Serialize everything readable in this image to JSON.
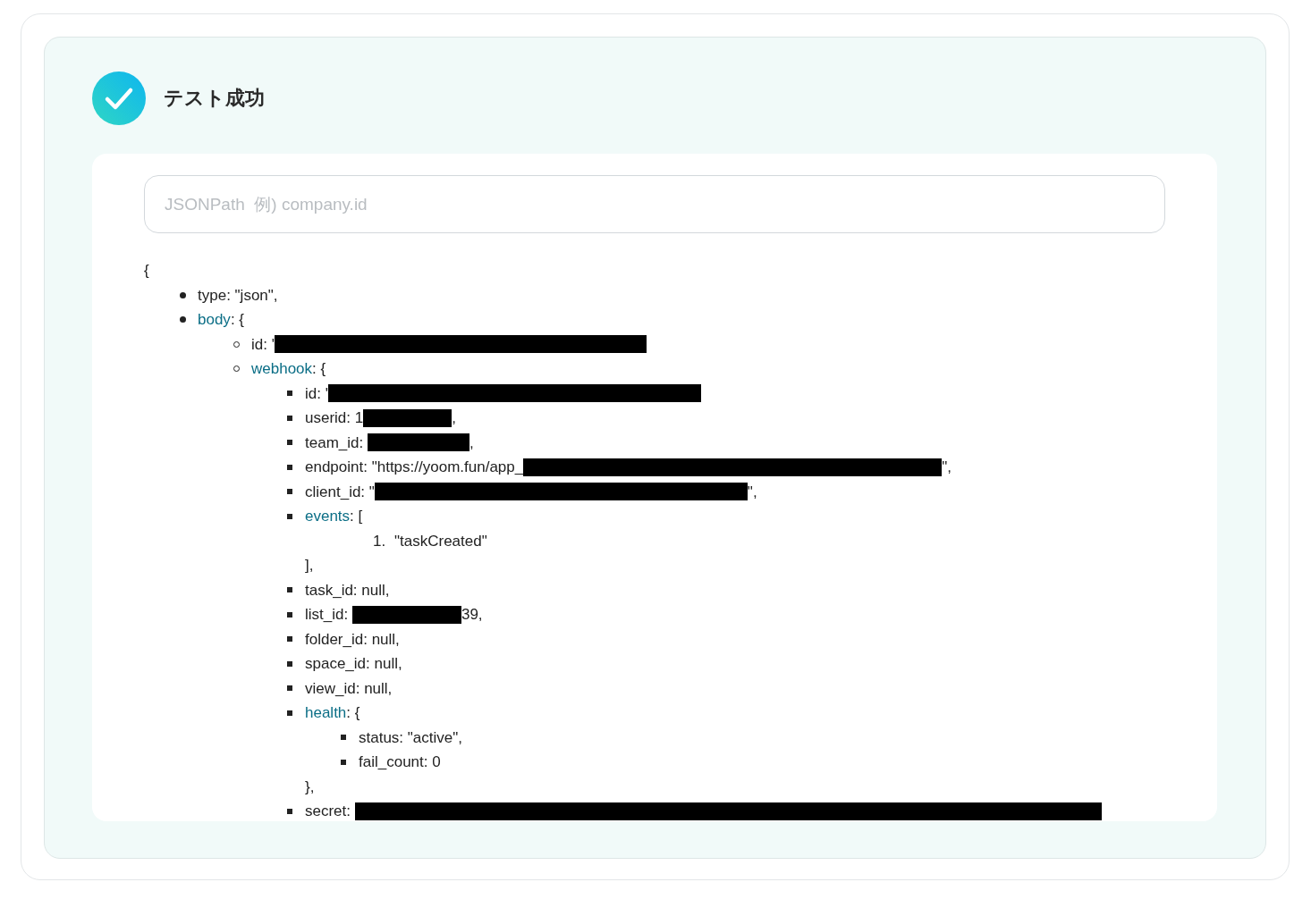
{
  "header": {
    "title": "テスト成功",
    "success": true
  },
  "search": {
    "placeholder": "JSONPath  例) company.id"
  },
  "tree": {
    "open": "{",
    "items": [
      {
        "parts": [
          {
            "kind": "text",
            "text": "type: \"json\","
          }
        ]
      },
      {
        "parts": [
          {
            "kind": "link",
            "text": "body"
          },
          {
            "kind": "text",
            "text": ": {"
          }
        ],
        "children": [
          {
            "parts": [
              {
                "kind": "text",
                "text": "id: '"
              },
              {
                "kind": "redaction"
              }
            ]
          },
          {
            "parts": [
              {
                "kind": "link",
                "text": "webhook"
              },
              {
                "kind": "text",
                "text": ": {"
              }
            ],
            "children": [
              {
                "parts": [
                  {
                    "kind": "text",
                    "text": "id: '"
                  },
                  {
                    "kind": "redaction"
                  }
                ]
              },
              {
                "parts": [
                  {
                    "kind": "text",
                    "text": "userid: 1"
                  },
                  {
                    "kind": "redaction"
                  },
                  {
                    "kind": "text",
                    "text": ","
                  }
                ]
              },
              {
                "parts": [
                  {
                    "kind": "text",
                    "text": "team_id: "
                  },
                  {
                    "kind": "redaction"
                  },
                  {
                    "kind": "text",
                    "text": ","
                  }
                ]
              },
              {
                "parts": [
                  {
                    "kind": "text",
                    "text": "endpoint: \"https://yoom.fun/app_"
                  },
                  {
                    "kind": "redaction"
                  },
                  {
                    "kind": "text",
                    "text": "\","
                  }
                ]
              },
              {
                "parts": [
                  {
                    "kind": "text",
                    "text": "client_id: \""
                  },
                  {
                    "kind": "redaction"
                  },
                  {
                    "kind": "text",
                    "text": "\","
                  }
                ]
              },
              {
                "parts": [
                  {
                    "kind": "link",
                    "text": "events"
                  },
                  {
                    "kind": "text",
                    "text": ": ["
                  }
                ],
                "ordered": true,
                "children": [
                  {
                    "marker": "1.",
                    "parts": [
                      {
                        "kind": "text",
                        "text": "\"taskCreated\""
                      }
                    ]
                  }
                ],
                "close": "],"
              },
              {
                "parts": [
                  {
                    "kind": "text",
                    "text": "task_id: null,"
                  }
                ]
              },
              {
                "parts": [
                  {
                    "kind": "text",
                    "text": "list_id: "
                  },
                  {
                    "kind": "redaction"
                  },
                  {
                    "kind": "text",
                    "text": "39,"
                  }
                ]
              },
              {
                "parts": [
                  {
                    "kind": "text",
                    "text": "folder_id: null,"
                  }
                ]
              },
              {
                "parts": [
                  {
                    "kind": "text",
                    "text": "space_id: null,"
                  }
                ]
              },
              {
                "parts": [
                  {
                    "kind": "text",
                    "text": "view_id: null,"
                  }
                ]
              },
              {
                "parts": [
                  {
                    "kind": "link",
                    "text": "health"
                  },
                  {
                    "kind": "text",
                    "text": ": {"
                  }
                ],
                "children": [
                  {
                    "parts": [
                      {
                        "kind": "text",
                        "text": "status: \"active\","
                      }
                    ]
                  },
                  {
                    "parts": [
                      {
                        "kind": "text",
                        "text": "fail_count: 0"
                      }
                    ]
                  }
                ],
                "close": "},"
              },
              {
                "parts": [
                  {
                    "kind": "text",
                    "text": "secret: "
                  },
                  {
                    "kind": "redaction"
                  }
                ]
              }
            ]
          }
        ]
      }
    ]
  }
}
